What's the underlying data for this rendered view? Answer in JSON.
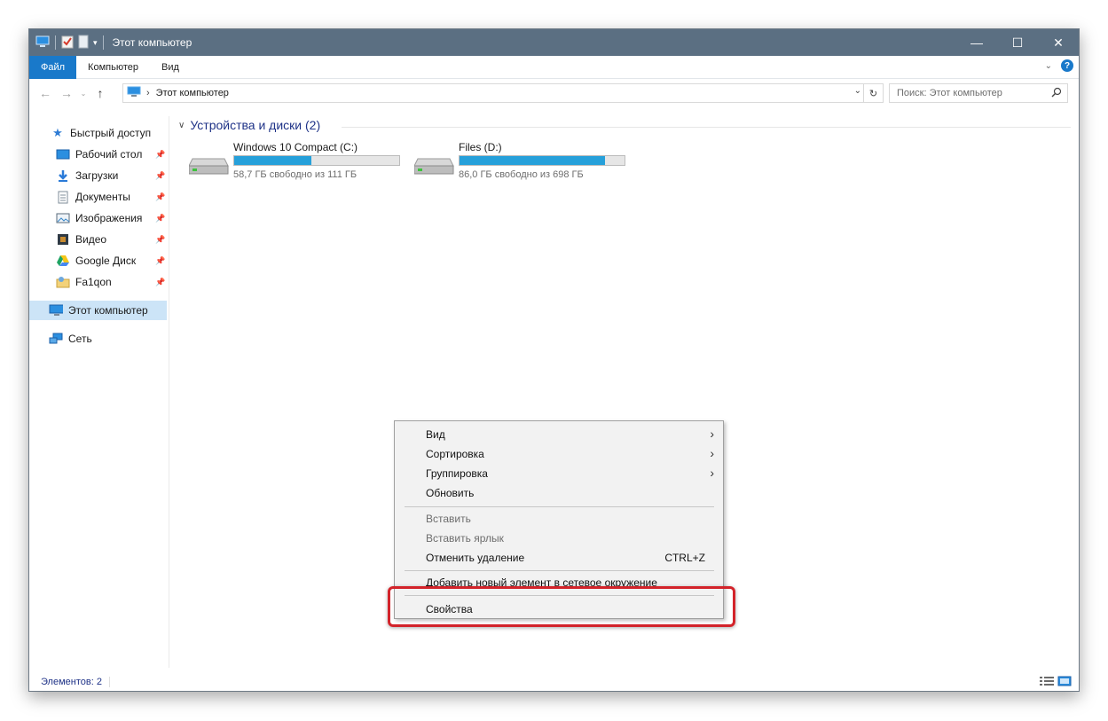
{
  "window": {
    "title": "Этот компьютер",
    "controls": [
      "—",
      "☐",
      "✕"
    ]
  },
  "ribbon": {
    "tabs": [
      "Файл",
      "Компьютер",
      "Вид"
    ]
  },
  "address": {
    "path": "Этот компьютер",
    "search_placeholder": "Поиск: Этот компьютер"
  },
  "nav": {
    "quick_access": "Быстрый доступ",
    "pinned": [
      {
        "label": "Рабочий стол",
        "icon": "desktop-icon"
      },
      {
        "label": "Загрузки",
        "icon": "downloads-icon"
      },
      {
        "label": "Документы",
        "icon": "documents-icon"
      },
      {
        "label": "Изображения",
        "icon": "pictures-icon"
      },
      {
        "label": "Видео",
        "icon": "videos-icon"
      },
      {
        "label": "Google Диск",
        "icon": "google-drive-icon"
      },
      {
        "label": "Fa1qon",
        "icon": "user-folder-icon"
      }
    ],
    "this_pc": "Этот компьютер",
    "network": "Сеть"
  },
  "content": {
    "group_title": "Устройства и диски (2)",
    "drives": [
      {
        "name": "Windows 10 Compact (C:)",
        "free_text": "58,7 ГБ свободно из 111 ГБ",
        "used_fraction": 0.47
      },
      {
        "name": "Files (D:)",
        "free_text": "86,0 ГБ свободно из 698 ГБ",
        "used_fraction": 0.88
      }
    ]
  },
  "status": {
    "items_count": "Элементов: 2"
  },
  "context_menu": {
    "items": [
      {
        "label": "Вид",
        "submenu": true,
        "disabled": false
      },
      {
        "label": "Сортировка",
        "submenu": true,
        "disabled": false
      },
      {
        "label": "Группировка",
        "submenu": true,
        "disabled": false
      },
      {
        "label": "Обновить",
        "submenu": false,
        "disabled": false
      },
      {
        "label": "Вставить",
        "submenu": false,
        "disabled": true
      },
      {
        "label": "Вставить ярлык",
        "submenu": false,
        "disabled": true
      },
      {
        "label": "Отменить удаление",
        "shortcut": "CTRL+Z",
        "submenu": false,
        "disabled": false
      },
      {
        "label": "Добавить новый элемент в сетевое окружение",
        "submenu": false,
        "disabled": false
      },
      {
        "label": "Свойства",
        "submenu": false,
        "disabled": false
      }
    ]
  },
  "colors": {
    "title_bar": "#5b6f82",
    "file_tab": "#1979ca",
    "drive_bar_fill": "#26a0da",
    "highlight_border": "#d3232a",
    "selected_nav": "#cce4f7"
  }
}
